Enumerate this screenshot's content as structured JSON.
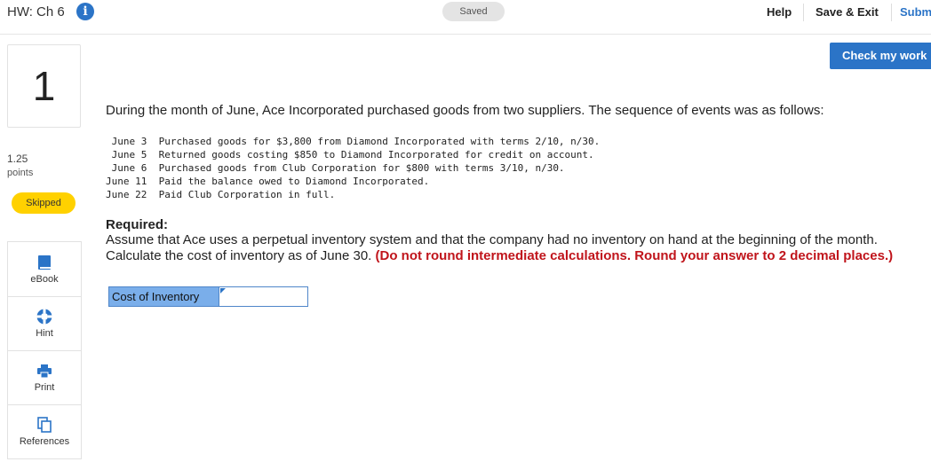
{
  "header": {
    "assignment_title": "HW: Ch 6",
    "info_icon": "info-icon",
    "saved_status": "Saved",
    "help_label": "Help",
    "save_exit_label": "Save & Exit",
    "submit_label": "Subm"
  },
  "question": {
    "number": "1",
    "points_value": "1.25",
    "points_label": "points",
    "status_badge": "Skipped"
  },
  "tools": [
    {
      "label": "eBook",
      "icon": "book-icon"
    },
    {
      "label": "Hint",
      "icon": "lifebuoy-icon"
    },
    {
      "label": "Print",
      "icon": "printer-icon"
    },
    {
      "label": "References",
      "icon": "copy-icon"
    }
  ],
  "main": {
    "check_label": "Check my work",
    "intro": "During the month of June, Ace Incorporated purchased goods from two suppliers. The sequence of events was as follows:",
    "events": [
      " June 3  Purchased goods for $3,800 from Diamond Incorporated with terms 2/10, n/30.",
      " June 5  Returned goods costing $850 to Diamond Incorporated for credit on account.",
      " June 6  Purchased goods from Club Corporation for $800 with terms 3/10, n/30.",
      "June 11  Paid the balance owed to Diamond Incorporated.",
      "June 22  Paid Club Corporation in full."
    ],
    "required_heading": "Required:",
    "required_line1": "Assume that Ace uses a perpetual inventory system and that the company had no inventory on hand at the beginning of the month.",
    "required_line2_plain": "Calculate the cost of inventory as of June 30. ",
    "required_line2_emphasis": "(Do not round intermediate calculations. Round your answer to 2 decimal places.)",
    "answer_label": "Cost of Inventory",
    "answer_value": ""
  },
  "colors": {
    "accent": "#2b74c7",
    "status_yellow": "#ffd100",
    "emphasis_red": "#c0141b",
    "answer_label_bg": "#7aaeea"
  }
}
